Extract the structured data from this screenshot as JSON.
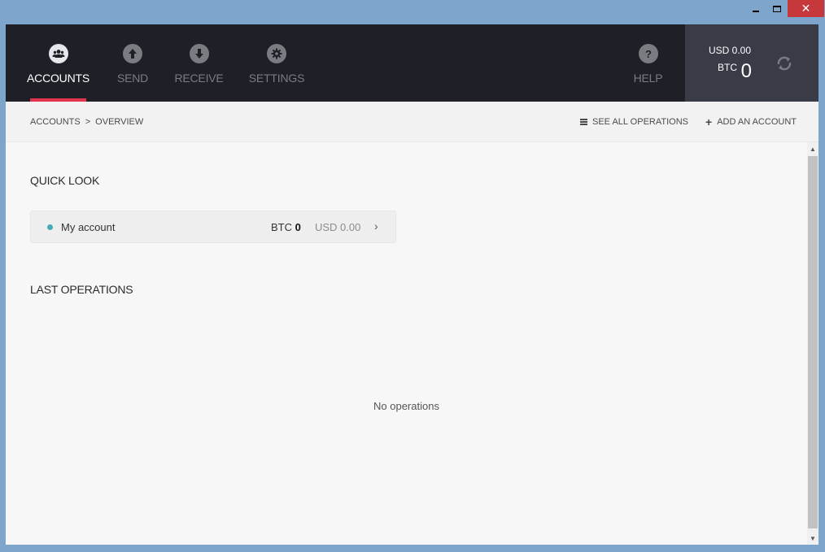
{
  "window": {
    "minimize_glyph": "minimize-icon",
    "maximize_glyph": "maximize-icon",
    "close_glyph": "✕"
  },
  "nav": {
    "items": [
      {
        "label": "ACCOUNTS",
        "icon": "users-icon",
        "active": true
      },
      {
        "label": "SEND",
        "icon": "arrow-up-icon",
        "active": false
      },
      {
        "label": "RECEIVE",
        "icon": "arrow-down-icon",
        "active": false
      },
      {
        "label": "SETTINGS",
        "icon": "gear-icon",
        "active": false
      },
      {
        "label": "HELP",
        "icon": "question-icon",
        "active": false
      }
    ],
    "accent_color": "#e3344d"
  },
  "balance": {
    "usd_label": "USD 0.00",
    "btc_label": "BTC",
    "btc_value": "0",
    "refresh_icon": "refresh-icon"
  },
  "subheader": {
    "breadcrumb": [
      "ACCOUNTS",
      ">",
      "OVERVIEW"
    ],
    "see_all_operations": "SEE ALL OPERATIONS",
    "add_account": "ADD AN ACCOUNT"
  },
  "quick_look": {
    "title": "QUICK LOOK",
    "accounts": [
      {
        "name": "My account",
        "btc_prefix": "BTC",
        "btc_value": "0",
        "usd": "USD 0.00",
        "dot_color": "#46a8b8"
      }
    ]
  },
  "last_operations": {
    "title": "LAST OPERATIONS",
    "empty_text": "No operations"
  }
}
